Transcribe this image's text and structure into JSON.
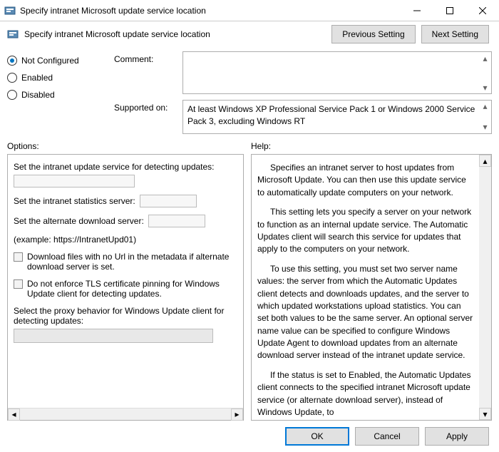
{
  "titlebar": {
    "title": "Specify intranet Microsoft update service location"
  },
  "header": {
    "title": "Specify intranet Microsoft update service location",
    "prev": "Previous Setting",
    "next": "Next Setting"
  },
  "radios": {
    "not_configured": "Not Configured",
    "enabled": "Enabled",
    "disabled": "Disabled",
    "selected": "not_configured"
  },
  "labels": {
    "comment": "Comment:",
    "supported_on": "Supported on:",
    "options": "Options:",
    "help": "Help:"
  },
  "comment_value": "",
  "supported_text": "At least Windows XP Professional Service Pack 1 or Windows 2000 Service Pack 3, excluding Windows RT",
  "options": {
    "detect_label": "Set the intranet update service for detecting updates:",
    "stats_label": "Set the intranet statistics server:",
    "alt_label": "Set the alternate download server:",
    "example": "(example: https://IntranetUpd01)",
    "cb1": "Download files with no Url in the metadata if alternate download server is set.",
    "cb2": "Do not enforce TLS certificate pinning for Windows Update client for detecting updates.",
    "proxy_label": "Select the proxy behavior for Windows Update client for detecting updates:"
  },
  "help": {
    "p1": "Specifies an intranet server to host updates from Microsoft Update. You can then use this update service to automatically update computers on your network.",
    "p2": "This setting lets you specify a server on your network to function as an internal update service. The Automatic Updates client will search this service for updates that apply to the computers on your network.",
    "p3": "To use this setting, you must set two server name values: the server from which the Automatic Updates client detects and downloads updates, and the server to which updated workstations upload statistics. You can set both values to be the same server. An optional server name value can be specified to configure Windows Update Agent to download updates from an alternate download server instead of the intranet update service.",
    "p4": "If the status is set to Enabled, the Automatic Updates client connects to the specified intranet Microsoft update service (or alternate download server), instead of Windows Update, to"
  },
  "footer": {
    "ok": "OK",
    "cancel": "Cancel",
    "apply": "Apply"
  }
}
